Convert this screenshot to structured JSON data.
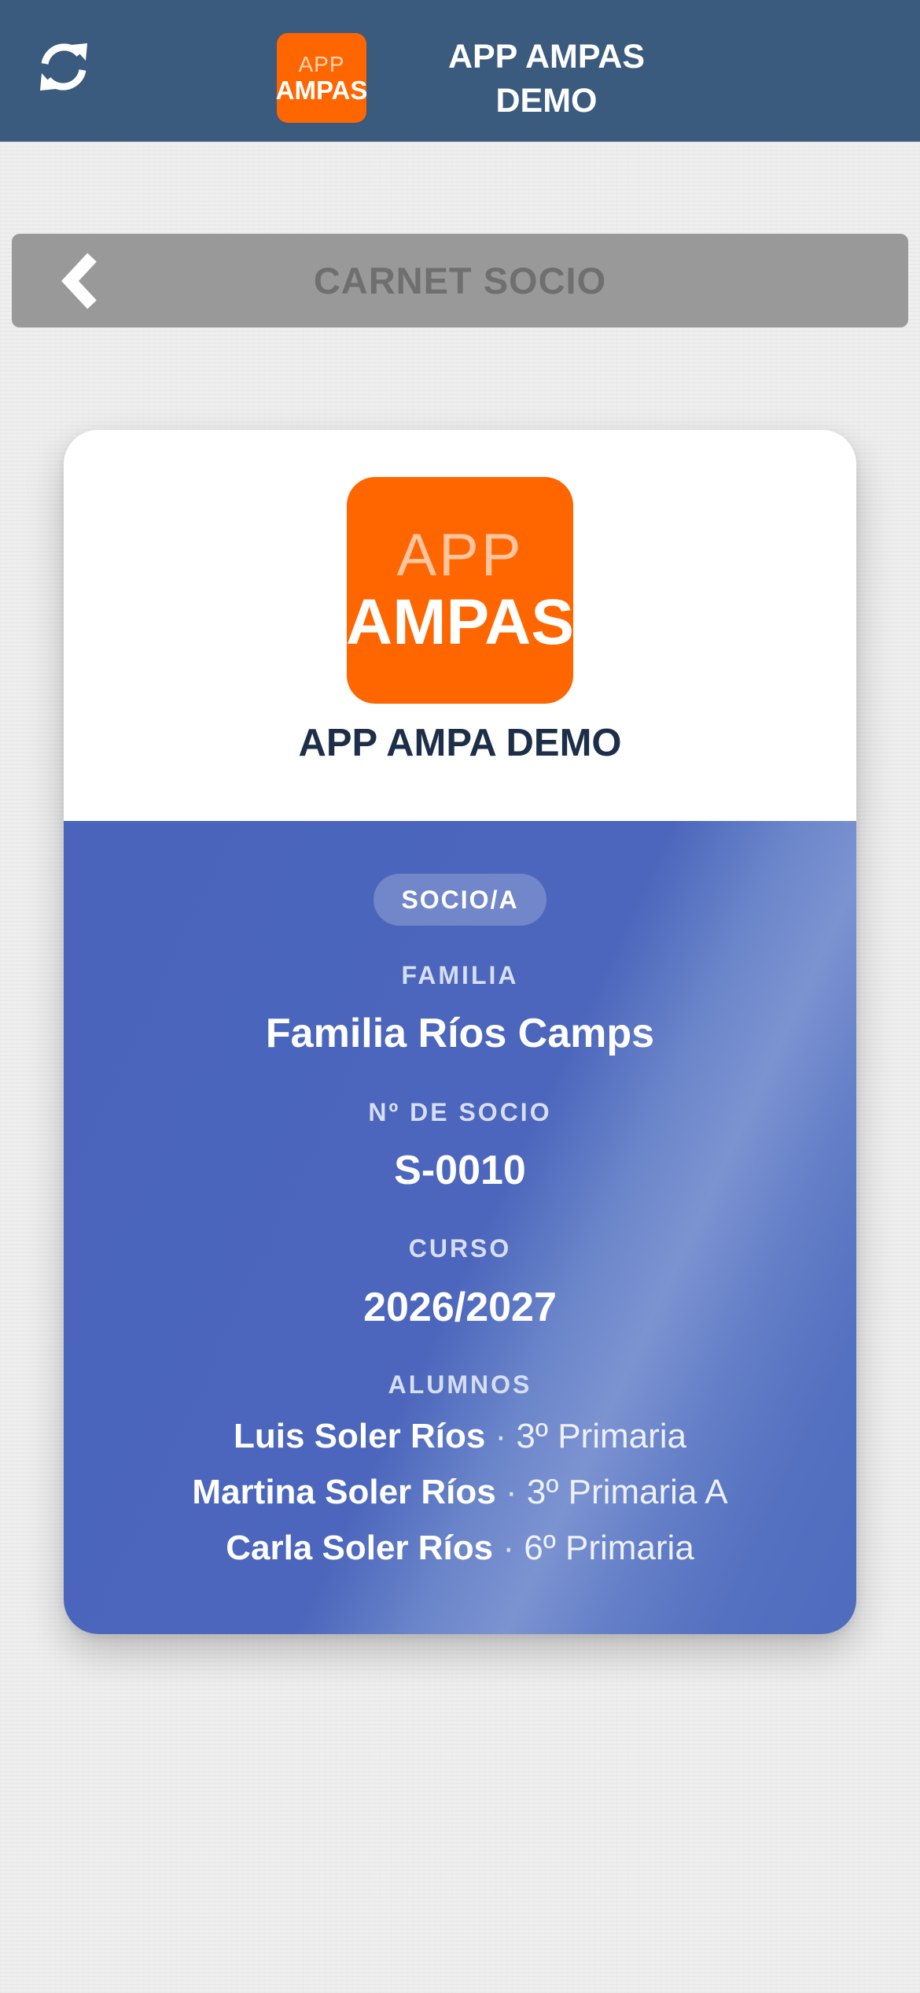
{
  "header": {
    "refresh_icon": "refresh-icon",
    "logo_line1": "APP",
    "logo_line2": "AMPAS",
    "title_line1": "APP AMPAS",
    "title_line2": "DEMO",
    "background_color": "#3a5a7e"
  },
  "section": {
    "back_icon": "chevron-left-icon",
    "title": "CARNET SOCIO"
  },
  "card": {
    "logo_line1": "APP",
    "logo_line2": "AMPAS",
    "organization": "APP AMPA DEMO",
    "badge": "SOCIO/A",
    "family_label": "FAMILIA",
    "family_value": "Familia Ríos Camps",
    "member_label": "Nº DE SOCIO",
    "member_value": "S-0010",
    "course_label": "CURSO",
    "course_value": "2026/2027",
    "students_label": "ALUMNOS",
    "separator": "·",
    "students": [
      {
        "name": "Luis Soler Ríos",
        "grade": "3º Primaria"
      },
      {
        "name": "Martina Soler Ríos",
        "grade": "3º Primaria A"
      },
      {
        "name": "Carla Soler Ríos",
        "grade": "6º Primaria"
      }
    ],
    "accent_color": "#4a64bb",
    "logo_color": "#ff6600"
  }
}
